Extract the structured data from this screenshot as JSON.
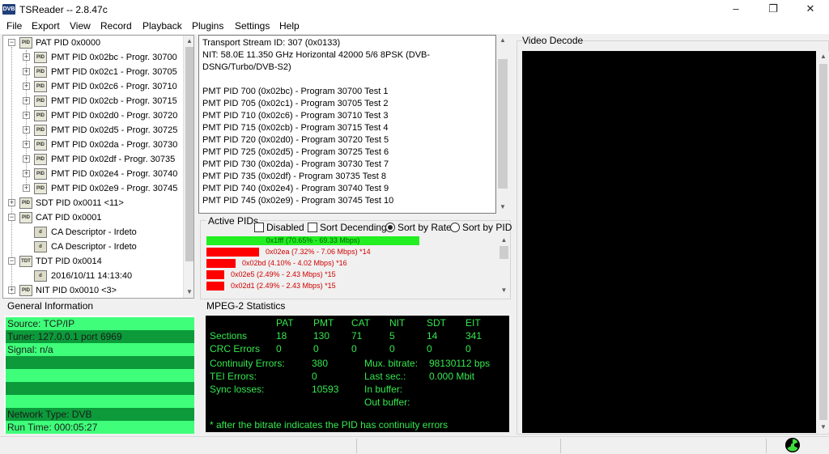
{
  "window": {
    "icon_text": "DVB",
    "title": "TSReader -- 2.8.47c",
    "minimize": "–",
    "restore": "❐",
    "close": "✕"
  },
  "menu": [
    "File",
    "Export",
    "View",
    "Record",
    "Playback",
    "Plugins",
    "Settings",
    "Help"
  ],
  "tree": {
    "pat": "PAT PID 0x0000",
    "pmts": [
      "PMT PID 0x02bc - Progr. 30700",
      "PMT PID 0x02c1 - Progr. 30705",
      "PMT PID 0x02c6 - Progr. 30710",
      "PMT PID 0x02cb - Progr. 30715",
      "PMT PID 0x02d0 - Progr. 30720",
      "PMT PID 0x02d5 - Progr. 30725",
      "PMT PID 0x02da - Progr. 30730",
      "PMT PID 0x02df - Progr. 30735",
      "PMT PID 0x02e4 - Progr. 30740",
      "PMT PID 0x02e9 - Progr. 30745"
    ],
    "sdt": "SDT PID 0x0011 <11>",
    "cat": "CAT PID 0x0001",
    "ca1": "CA Descriptor - Irdeto",
    "ca2": "CA Descriptor - Irdeto",
    "tdt": "TDT PID 0x0014",
    "tdt_date": "2016/10/11 14:13:40",
    "nit": "NIT PID 0x0010 <3>"
  },
  "info": {
    "lines": [
      "Transport Stream ID: 307 (0x0133)",
      "NIT: 58.0E 11.350 GHz Horizontal 42000 5/6 8PSK (DVB-",
      "DSNG/Turbo/DVB-S2)",
      "",
      "PMT PID 700 (0x02bc) - Program 30700 Test 1",
      "PMT PID 705 (0x02c1) - Program 30705 Test 2",
      "PMT PID 710 (0x02c6) - Program 30710 Test 3",
      "PMT PID 715 (0x02cb) - Program 30715 Test 4",
      "PMT PID 720 (0x02d0) - Program 30720 Test 5",
      "PMT PID 725 (0x02d5) - Program 30725 Test 6",
      "PMT PID 730 (0x02da) - Program 30730 Test 7",
      "PMT PID 735 (0x02df) - Program 30735 Test 8",
      "PMT PID 740 (0x02e4) - Program 30740 Test 9",
      "PMT PID 745 (0x02e9) - Program 30745 Test 10"
    ]
  },
  "active_pids": {
    "legend": "Active PIDs",
    "disabled": "Disabled",
    "sort_desc": "Sort Decending",
    "sort_rate": "Sort by Rate",
    "sort_pid": "Sort by PID",
    "rows": [
      {
        "label": "0x1fff (70.65% - 69.33 Mbps)",
        "percent": 70.65,
        "color": "#22ee22",
        "text_color": "#006400",
        "inside": true
      },
      {
        "label": "0x02ea (7.32% - 7.06 Mbps) *14",
        "percent": 7.32,
        "color": "#ff0000",
        "text_color": "#d00000",
        "inside": false
      },
      {
        "label": "0x02bd (4.10% - 4.02 Mbps) *16",
        "percent": 4.1,
        "color": "#ff0000",
        "text_color": "#d00000",
        "inside": false
      },
      {
        "label": "0x02e5 (2.49% - 2.43 Mbps) *15",
        "percent": 2.49,
        "color": "#ff0000",
        "text_color": "#d00000",
        "inside": false
      },
      {
        "label": "0x02d1 (2.49% - 2.43 Mbps) *15",
        "percent": 2.49,
        "color": "#ff0000",
        "text_color": "#d00000",
        "inside": false
      }
    ]
  },
  "general_info": {
    "legend": "General Information",
    "rows": [
      "Source: TCP/IP",
      "Tuner: 127.0.0.1 port 6969",
      "Signal: n/a",
      "",
      "",
      "",
      "",
      "Network Type: DVB",
      "Run Time: 000:05:27"
    ]
  },
  "mpeg": {
    "legend": "MPEG-2 Statistics",
    "headers": [
      "PAT",
      "PMT",
      "CAT",
      "NIT",
      "SDT",
      "EIT"
    ],
    "sections_label": "Sections",
    "sections": [
      "18",
      "130",
      "71",
      "5",
      "14",
      "341"
    ],
    "crc_label": "CRC Errors",
    "crc": [
      "0",
      "0",
      "0",
      "0",
      "0",
      "0"
    ],
    "continuity_label": "Continuity Errors:",
    "continuity": "380",
    "tei_label": "TEI Errors:",
    "tei": "0",
    "sync_label": "Sync losses:",
    "sync": "10593",
    "mux_label": "Mux. bitrate:",
    "mux": "98130112 bps",
    "last_label": "Last sec.:",
    "last": "0.000 Mbit",
    "inbuf_label": "In buffer:",
    "outbuf_label": "Out buffer:",
    "footnote": "* after the bitrate indicates the PID has continuity errors"
  },
  "video": {
    "legend": "Video Decode"
  }
}
